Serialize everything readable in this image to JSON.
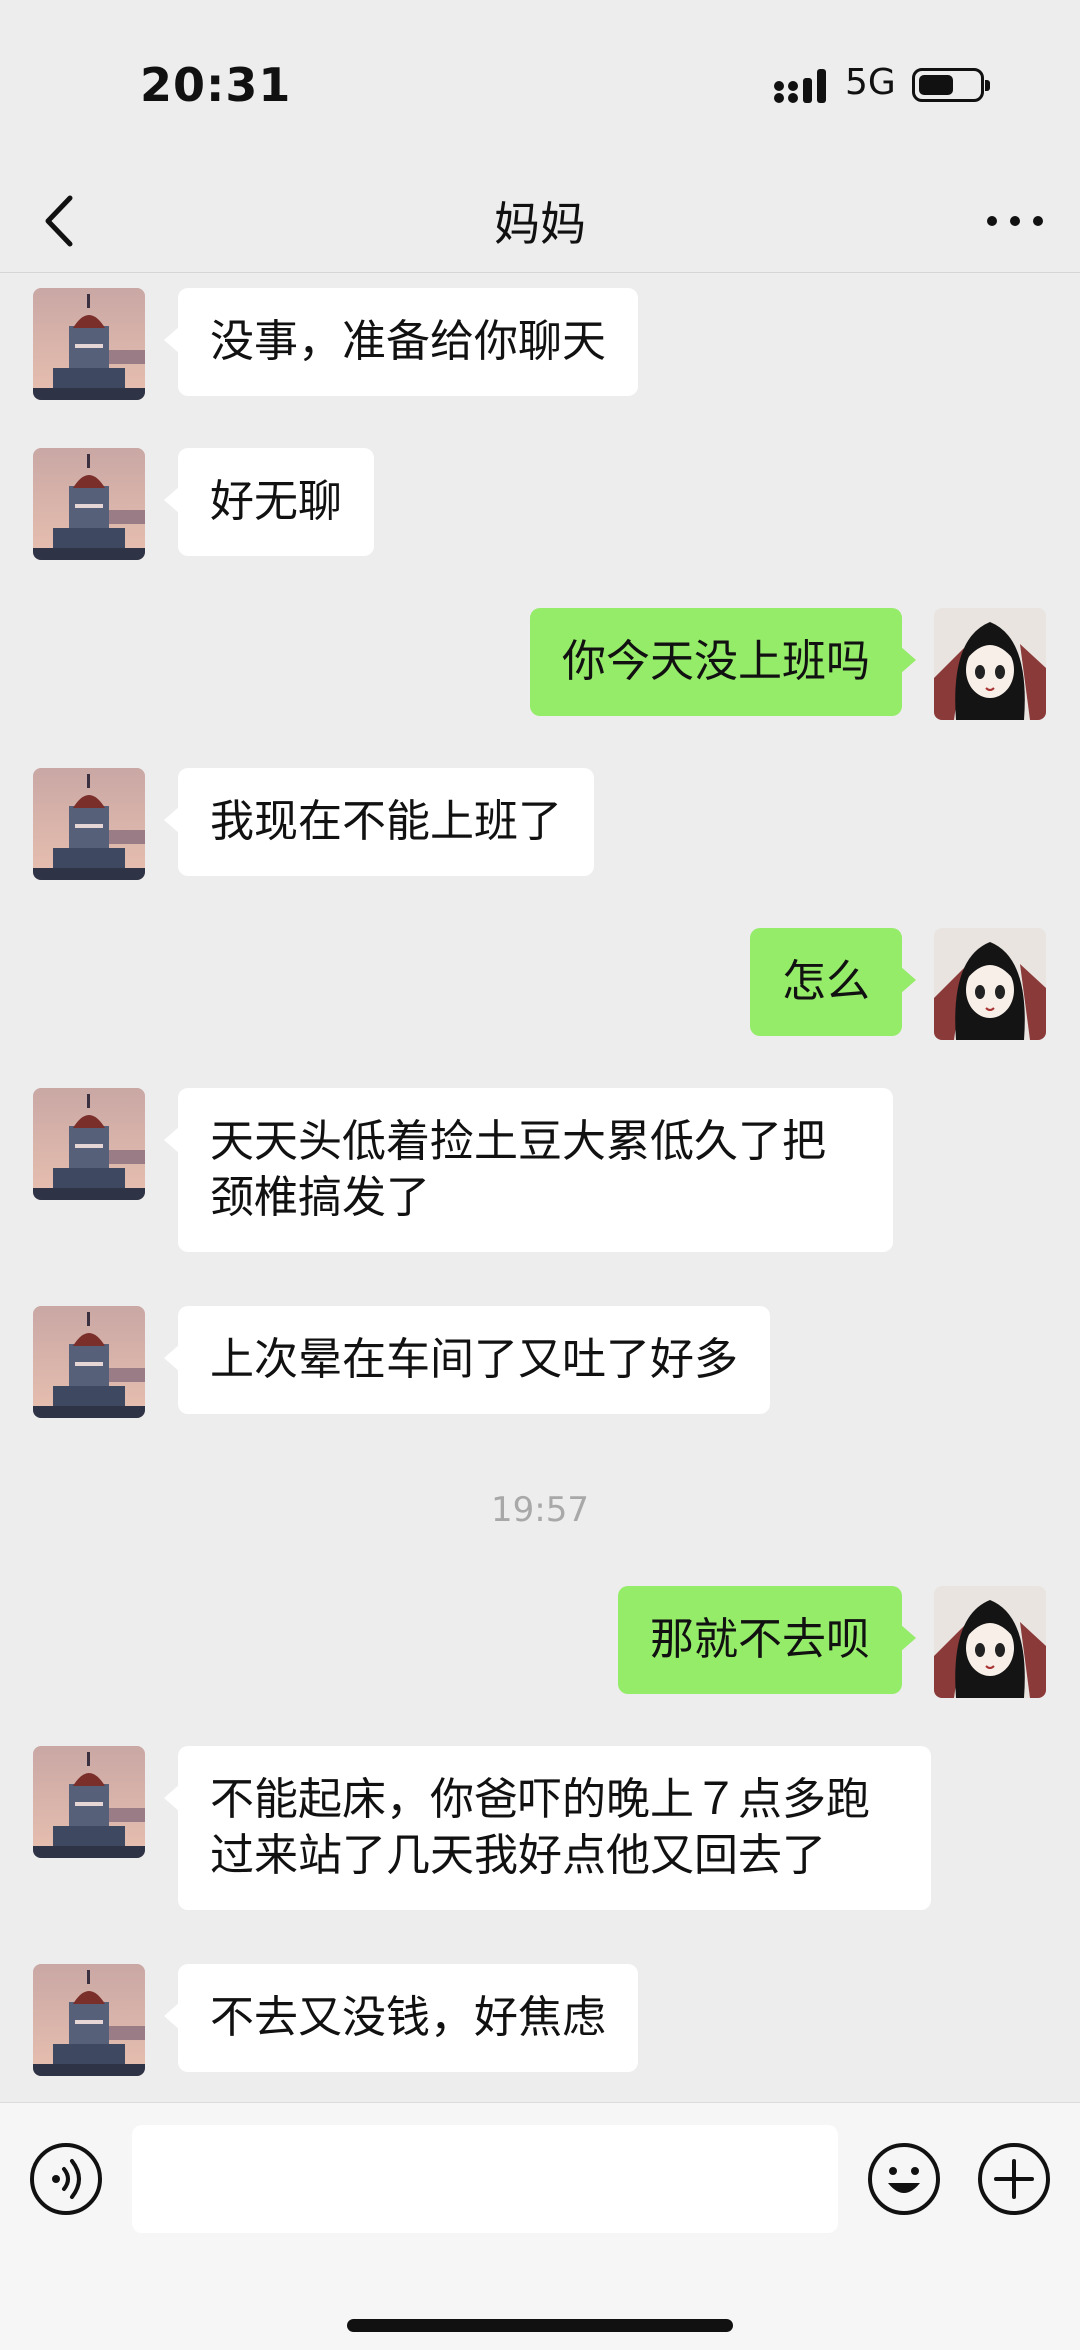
{
  "status_bar": {
    "time": "20:31",
    "network": "5G"
  },
  "header": {
    "title": "妈妈"
  },
  "messages": [
    {
      "side": "in",
      "text": "没事，准备给你聊天"
    },
    {
      "side": "in",
      "text": "好无聊"
    },
    {
      "side": "out",
      "text": "你今天没上班吗"
    },
    {
      "side": "in",
      "text": "我现在不能上班了"
    },
    {
      "side": "out",
      "text": "怎么"
    },
    {
      "side": "in",
      "text": "天天头低着捡土豆大累低久了把\n颈椎搞发了"
    },
    {
      "side": "in",
      "text": "上次晕在车间了又吐了好多"
    },
    {
      "side": "time",
      "text": "19:57"
    },
    {
      "side": "out",
      "text": "那就不去呗"
    },
    {
      "side": "in",
      "text": "不能起床，你爸吓的晚上７点多跑\n过来站了几天我好点他又回去了"
    },
    {
      "side": "in",
      "text": "不去又没钱，好焦虑"
    }
  ],
  "colors": {
    "background": "#ededed",
    "bubble_out": "#95ec69",
    "bubble_in": "#ffffff"
  }
}
